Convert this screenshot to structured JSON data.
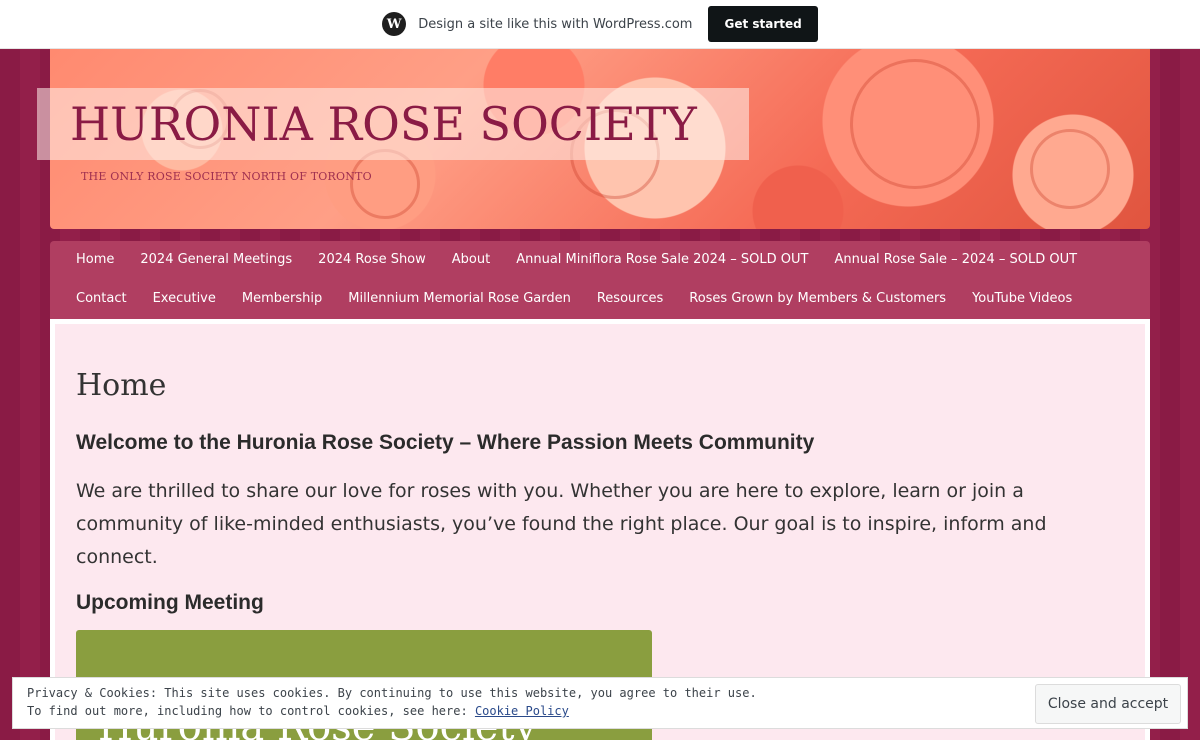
{
  "wpbar": {
    "logo_letter": "W",
    "text": "Design a site like this with WordPress.com",
    "button": "Get started"
  },
  "header": {
    "title": "HURONIA ROSE SOCIETY",
    "tagline": "THE ONLY ROSE SOCIETY NORTH OF TORONTO"
  },
  "nav": {
    "row1": [
      "Home",
      "2024 General Meetings",
      "2024 Rose Show",
      "About",
      "Annual Miniflora Rose Sale 2024 – SOLD OUT",
      "Annual Rose Sale – 2024 – SOLD OUT"
    ],
    "row2": [
      "Contact",
      "Executive",
      "Membership",
      "Millennium Memorial Rose Garden",
      "Resources",
      "Roses Grown by Members & Customers",
      "YouTube Videos"
    ]
  },
  "main": {
    "page_title": "Home",
    "welcome_heading": "Welcome to the Huronia Rose Society – Where Passion Meets Community",
    "intro": "We are thrilled to share our love for roses with you. Whether you are here to explore, learn or join a community of like-minded enthusiasts, you’ve found the right place. Our goal is to inspire, inform and connect.",
    "upcoming_heading": "Upcoming Meeting",
    "meeting_image_text": "Huronia Rose Society"
  },
  "cookie": {
    "line1": "Privacy & Cookies: This site uses cookies. By continuing to use this website, you agree to their use.",
    "line2_prefix": "To find out more, including how to control cookies, see here: ",
    "link": "Cookie Policy",
    "button": "Close and accept"
  },
  "colors": {
    "background": "#8a1b45",
    "nav": "#b03e61",
    "content": "#fde8ef",
    "meeting_image": "#8a9e3f"
  }
}
